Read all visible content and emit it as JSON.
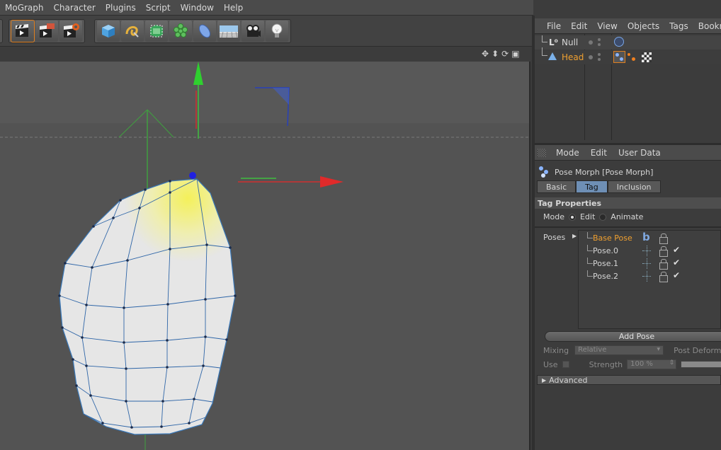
{
  "menubar": {
    "items": [
      "MoGraph",
      "Character",
      "Plugins",
      "Script",
      "Window",
      "Help"
    ]
  },
  "toolbar": {
    "group1": [
      "render-view-icon",
      "render-picture-viewer-icon",
      "render-settings-icon"
    ],
    "group2": [
      "cube-icon",
      "spline-pen-icon",
      "subdivision-surface-icon",
      "cloner-icon",
      "deformer-icon",
      "floor-icon",
      "camera-icon",
      "light-icon"
    ]
  },
  "object_manager": {
    "menu": [
      "File",
      "Edit",
      "View",
      "Objects",
      "Tags",
      "Bookm"
    ],
    "objects": [
      {
        "name": "Null",
        "color": "#d6d6d6"
      },
      {
        "name": "Head",
        "color": "#f0a030"
      }
    ]
  },
  "attribute_manager": {
    "menu": [
      "Mode",
      "Edit",
      "User Data"
    ],
    "title": "Pose Morph [Pose Morph]",
    "tabs": [
      "Basic",
      "Tag",
      "Inclusion"
    ],
    "active_tab": "Tag",
    "section": "Tag Properties",
    "mode_label": "Mode",
    "mode_options": [
      "Edit",
      "Animate"
    ],
    "mode_selected": "Edit",
    "poses_label": "Poses",
    "poses": [
      {
        "name": "Base Pose",
        "base": true
      },
      {
        "name": "Pose.0",
        "base": false
      },
      {
        "name": "Pose.1",
        "base": false
      },
      {
        "name": "Pose.2",
        "base": false
      }
    ],
    "base_marker": "b",
    "check_mark": "✔",
    "add_pose": "Add Pose",
    "mixing_label": "Mixing",
    "mixing_value": "Relative",
    "post_deform": "Post Deform",
    "use_label": "Use",
    "strength_label": "Strength",
    "strength_value": "100 %",
    "advanced": "Advanced"
  }
}
